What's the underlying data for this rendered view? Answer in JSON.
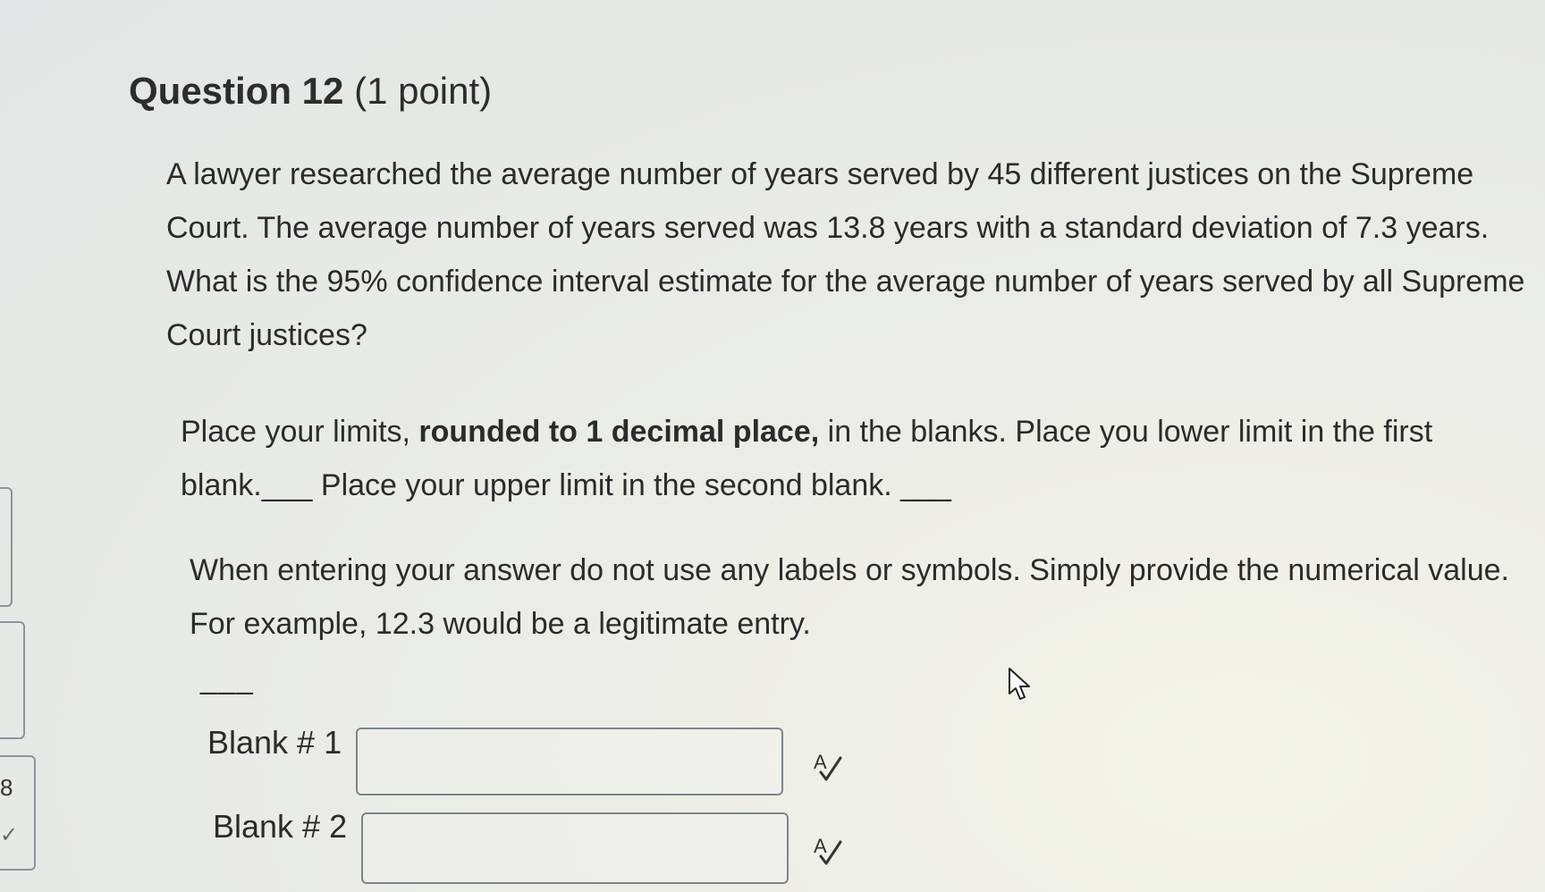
{
  "question": {
    "number_label": "Question 12",
    "points_label": "(1 point)",
    "paragraph1_lines": [
      "A lawyer researched the average number of years served by 45 different justices on the Supreme",
      "Court. The average number of years served was 13.8 years with a standard deviation of 7.3 years.",
      "What is the 95% confidence interval estimate for the average number of years served by all Supreme",
      "Court justices?"
    ],
    "paragraph2": {
      "line1_pre": "Place your limits, ",
      "line1_bold": "rounded to 1 decimal place,",
      "line1_post": " in the blanks. Place you lower limit in the first",
      "line2": "blank.___ Place your upper limit in the second blank. ___"
    },
    "paragraph3_lines": [
      "When entering your answer do not use any labels or symbols. Simply provide the numerical value.",
      "For example, 12.3 would be a legitimate entry."
    ],
    "divider": "___"
  },
  "blanks": [
    {
      "label": "Blank # 1",
      "value": ""
    },
    {
      "label": "Blank # 2",
      "value": ""
    }
  ],
  "left_edge": {
    "digit": "8"
  },
  "icons": {
    "spellcheck": "spellcheck-icon",
    "cursor": "mouse-pointer-icon"
  }
}
